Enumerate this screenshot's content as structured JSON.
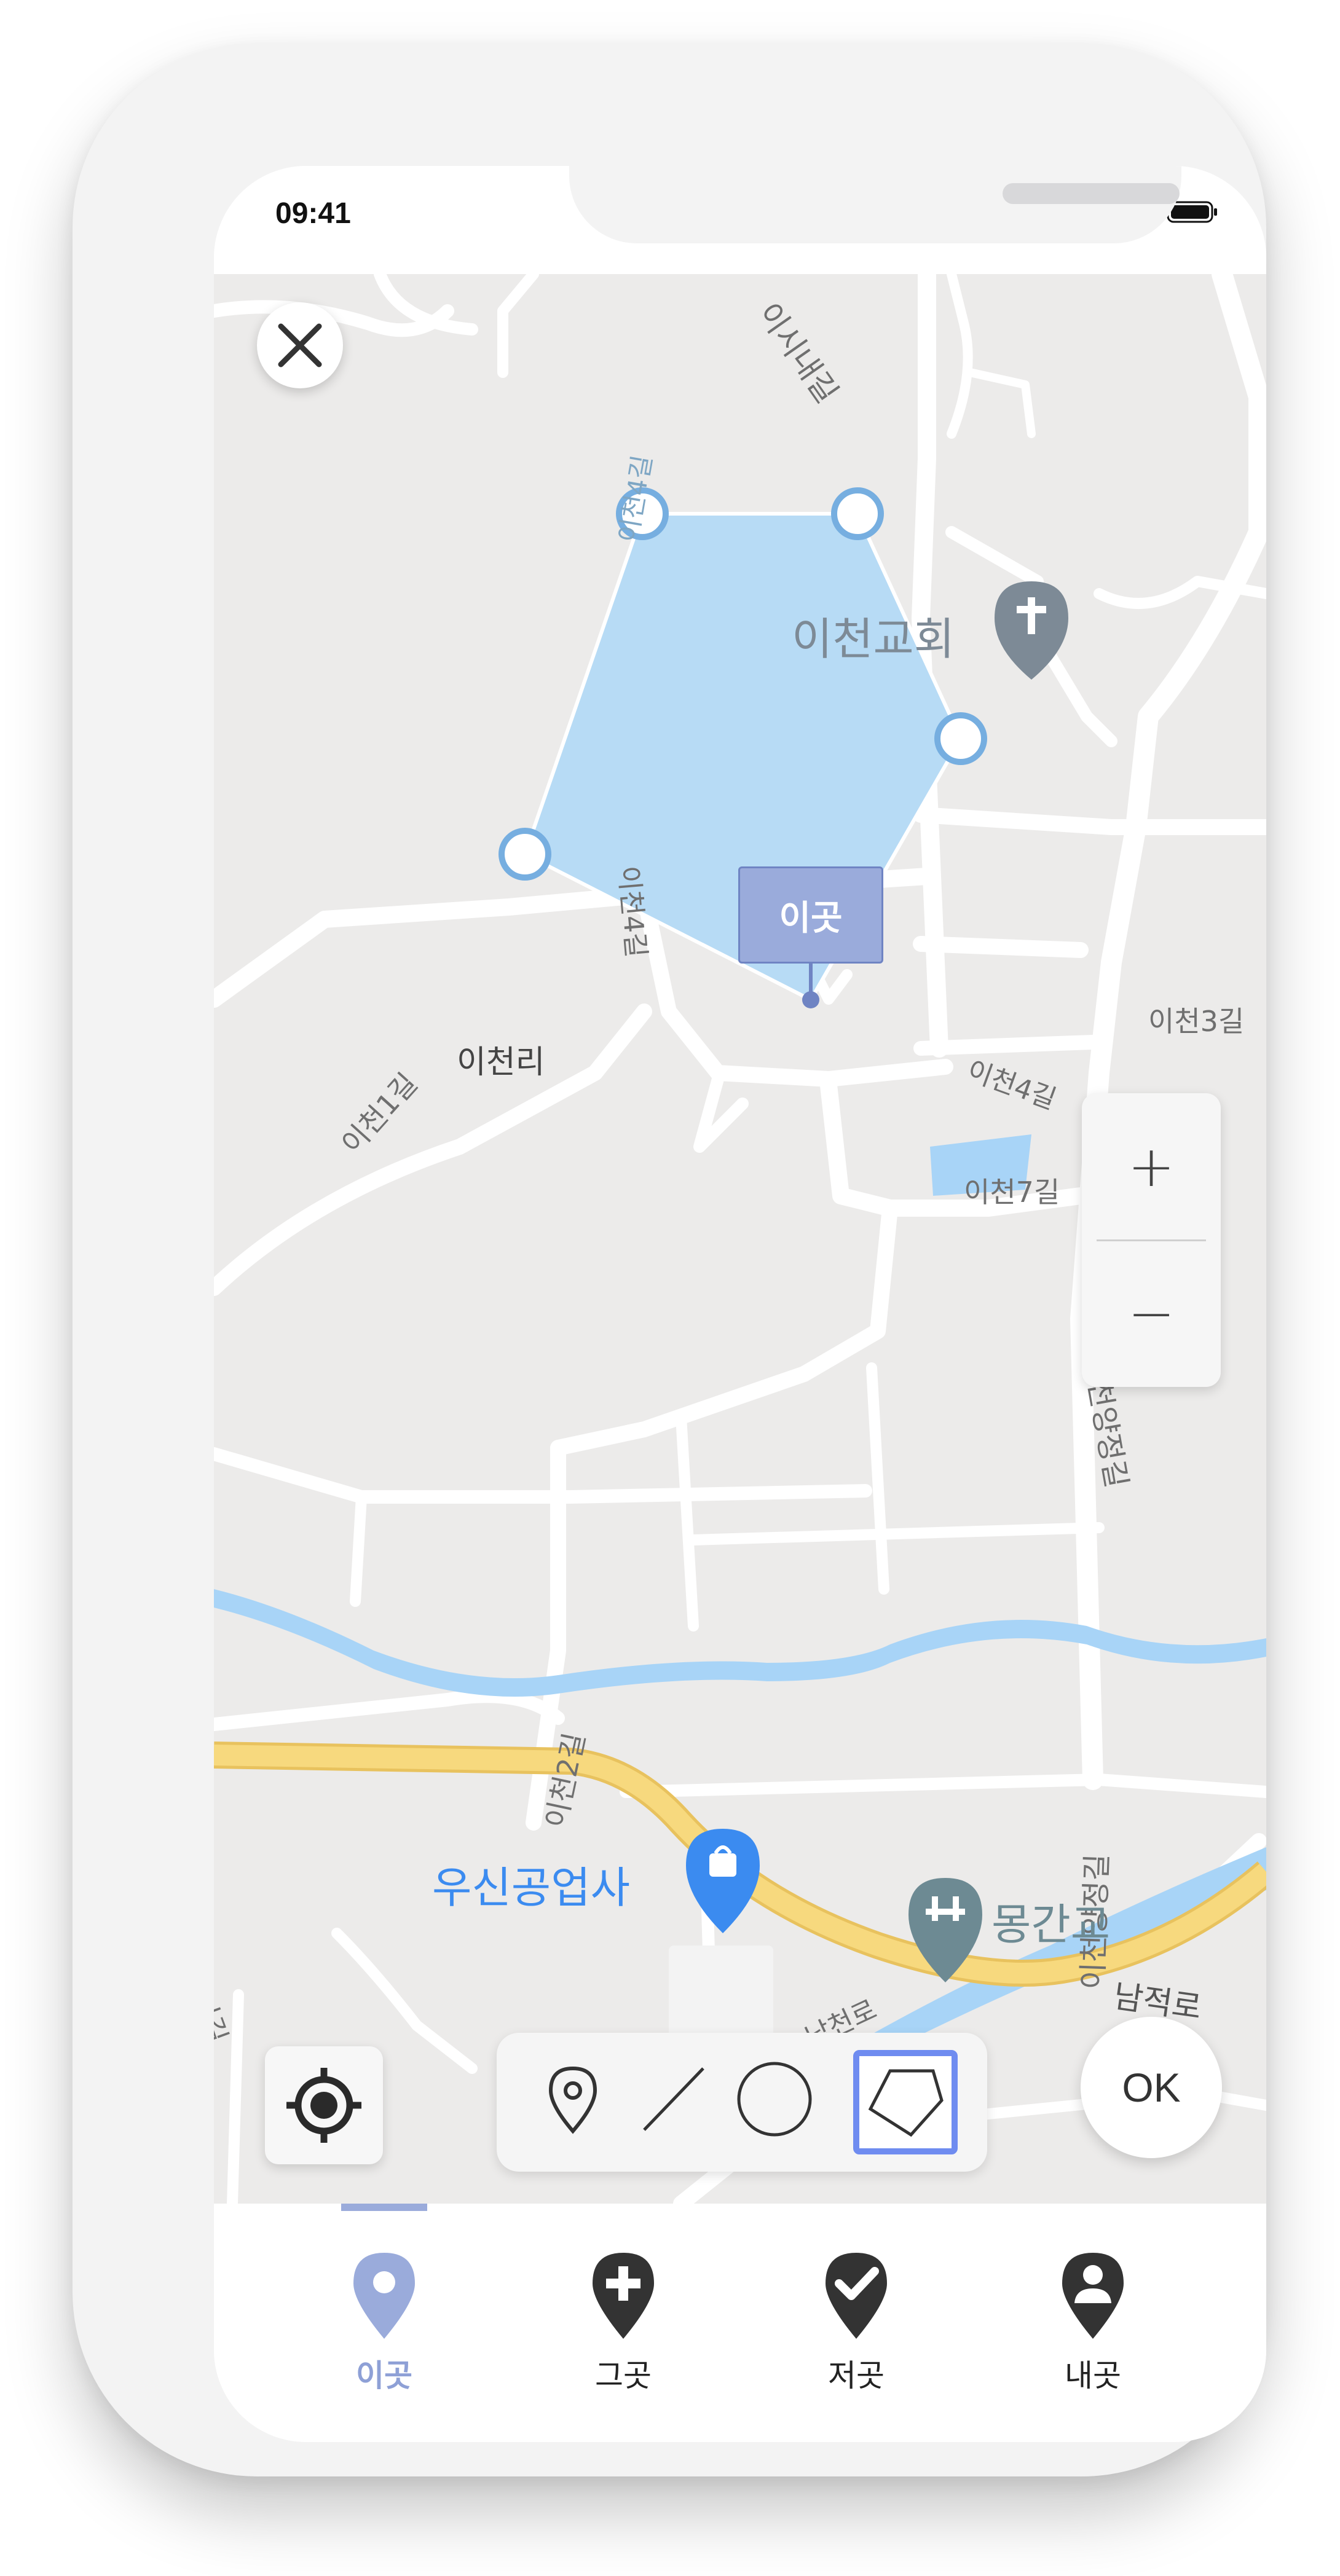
{
  "status_bar": {
    "time": "09:41"
  },
  "map": {
    "road_labels": [
      "이시내길",
      "이천4길",
      "이천4길",
      "이천1길",
      "이천3길",
      "이천4길",
      "이천7길",
      "이천양정길",
      "이천2길",
      "이천양정길",
      "남적로",
      "새나길",
      "남천로"
    ],
    "place_label": "이천리",
    "pois": {
      "church": "이천교회",
      "shop": "우신공업사",
      "bridge": "몽간교"
    },
    "marker_label": "이곳"
  },
  "controls": {
    "zoom_in": "+",
    "zoom_out": "−",
    "ok": "OK"
  },
  "draw_tools": {
    "selected": "polygon-tool",
    "items": [
      "pin-tool",
      "line-tool",
      "circle-tool",
      "polygon-tool"
    ]
  },
  "tabs": [
    {
      "label": "이곳",
      "icon": "location-pin-icon",
      "active": true
    },
    {
      "label": "그곳",
      "icon": "pin-plus-icon",
      "active": false
    },
    {
      "label": "저곳",
      "icon": "pin-check-icon",
      "active": false
    },
    {
      "label": "내곳",
      "icon": "pin-person-icon",
      "active": false
    }
  ],
  "colors": {
    "accent": "#9aabdb",
    "tool_selected": "#6f8cf0",
    "polygon_fill": "#b7dbf5",
    "polygon_stroke": "#76aee0",
    "map_bg": "#ecebea",
    "water": "#a8d4f7",
    "highway": "#f7d97e"
  }
}
